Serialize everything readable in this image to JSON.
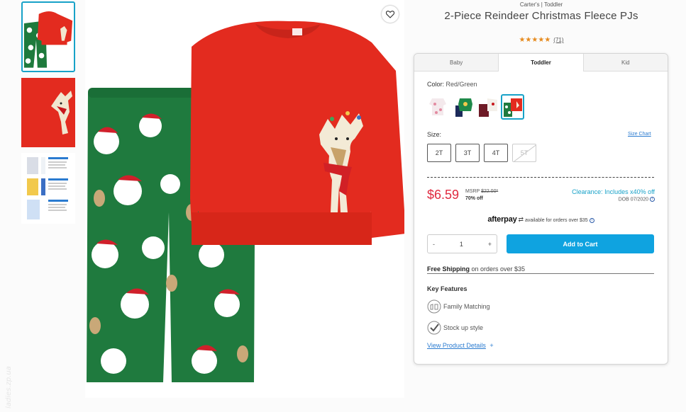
{
  "product": {
    "brand": "Carter's | Toddler",
    "title": "2-Piece Reindeer Christmas Fleece PJs",
    "rating_stars": "★★★★★",
    "rating_count": "(71)"
  },
  "tabs": [
    {
      "label": "Baby",
      "active": false
    },
    {
      "label": "Toddler",
      "active": true
    },
    {
      "label": "Kid",
      "active": false
    }
  ],
  "color": {
    "label": "Color:",
    "value": "Red/Green"
  },
  "swatches": [
    {
      "name": "Pink/White floral",
      "selected": false
    },
    {
      "name": "Green/Navy",
      "selected": false
    },
    {
      "name": "Burgundy/White",
      "selected": false
    },
    {
      "name": "Red/Green",
      "selected": true
    }
  ],
  "size": {
    "label": "Size:",
    "chart_link": "Size Chart",
    "options": [
      {
        "label": "2T",
        "available": true
      },
      {
        "label": "3T",
        "available": true
      },
      {
        "label": "4T",
        "available": true
      },
      {
        "label": "5T",
        "available": false
      }
    ]
  },
  "pricing": {
    "price": "$6.59",
    "msrp_label": "MSRP",
    "msrp_value": "$22.00*",
    "off": "70% off",
    "clearance": "Clearance: Includes x40% off",
    "dob": "DOB 07/2020"
  },
  "afterpay": {
    "logo": "afterpay",
    "text": "available for orders over $35"
  },
  "quantity": {
    "minus": "-",
    "value": "1",
    "plus": "+"
  },
  "add_to_cart": "Add to Cart",
  "shipping": {
    "bold": "Free Shipping",
    "rest": " on orders over $35"
  },
  "features": {
    "title": "Key Features",
    "items": [
      {
        "label": "Family Matching",
        "icon": "family-matching-icon"
      },
      {
        "label": "Stock up style",
        "icon": "checkmark-icon"
      }
    ]
  },
  "view_details": {
    "label": "View Product Details",
    "plus": "+"
  },
  "watermark": "ladies.zp.ua",
  "colors": {
    "accent": "#18a2c8",
    "price": "#e0293f",
    "button": "#0fa3e0",
    "stars": "#e68a1e"
  }
}
